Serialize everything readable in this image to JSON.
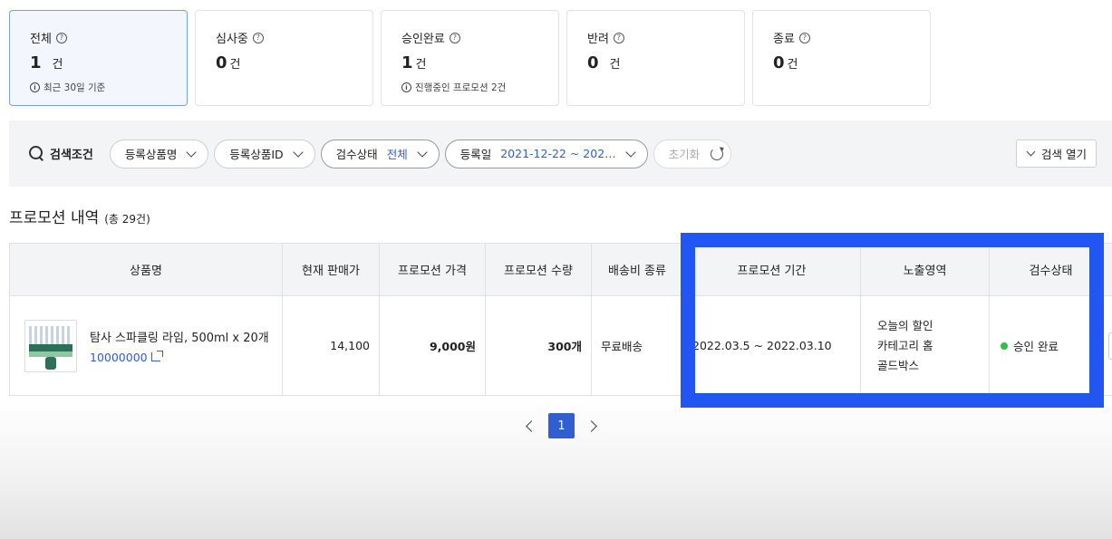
{
  "cards": [
    {
      "title": "전체",
      "count": "1",
      "unit": "건",
      "note": "최근 30일 기준"
    },
    {
      "title": "심사중",
      "count": "0",
      "unit": "건",
      "note": ""
    },
    {
      "title": "승인완료",
      "count": "1",
      "unit": "건",
      "note": "진행중인 프로모션 2건"
    },
    {
      "title": "반려",
      "count": "0",
      "unit": "건",
      "note": ""
    },
    {
      "title": "종료",
      "count": "0",
      "unit": "건",
      "note": ""
    }
  ],
  "search": {
    "label": "검색조건",
    "filters": [
      {
        "label": "등록상품명",
        "value": ""
      },
      {
        "label": "등록상품ID",
        "value": ""
      },
      {
        "label": "검수상태",
        "value": "전체"
      },
      {
        "label": "등록일",
        "value": "2021-12-22 ~ 202…"
      }
    ],
    "reset_label": "초기화",
    "open_label": "검색 열기"
  },
  "section": {
    "title": "프로모션 내역",
    "subtitle": "(총 29건)"
  },
  "table": {
    "headers": [
      "상품명",
      "현재 판매가",
      "프로모션 가격",
      "프로모션 수량",
      "배송비 종류",
      "프로모션 기간",
      "노출영역",
      "검수상태"
    ],
    "rows": [
      {
        "product_name": "탐사 스파클링 라임, 500ml x 20개",
        "product_id": "10000000",
        "current_price": "14,100",
        "promo_price": "9,000원",
        "promo_qty": "300개",
        "shipping": "무료배송",
        "period": "2022.03.5 ~ 2022.03.10",
        "areas": [
          "오늘의 할인",
          "카테고리 홈",
          "골드박스"
        ],
        "status": "승인 완료"
      }
    ]
  },
  "pagination": {
    "current": "1"
  },
  "colors": {
    "accent": "#2f5fd0",
    "highlight": "#2156f2",
    "status_ok": "#2fc04b"
  }
}
